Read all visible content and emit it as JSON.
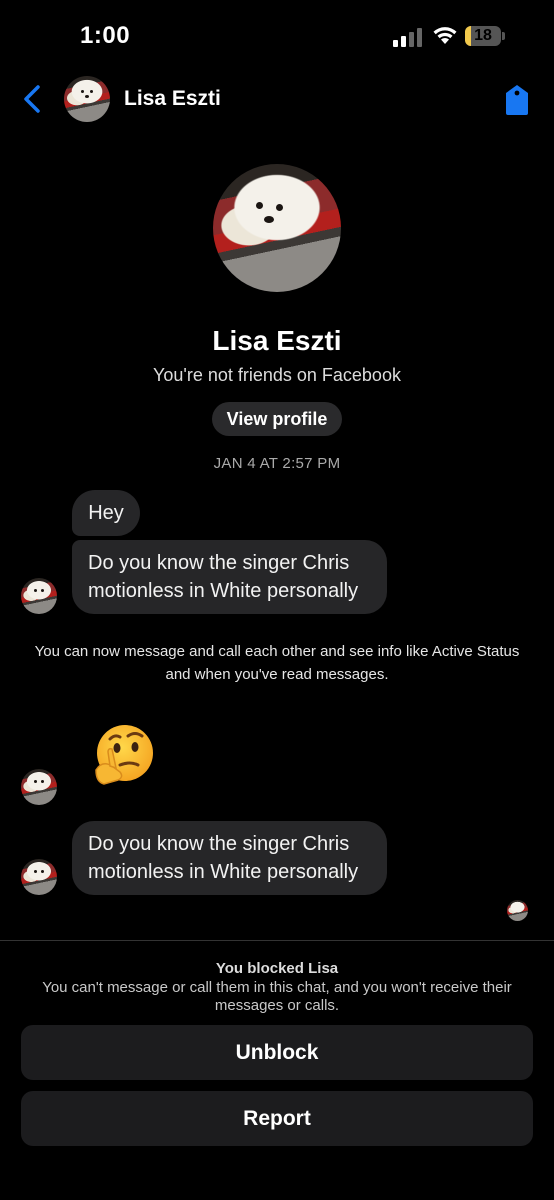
{
  "status_bar": {
    "time": "1:00",
    "battery": "18",
    "battery_level": 0.18,
    "battery_color": "#f2c94c"
  },
  "header": {
    "name": "Lisa Eszti",
    "accent_color": "#1877f2"
  },
  "profile": {
    "name": "Lisa Eszti",
    "subtitle": "You're not friends on Facebook",
    "view_profile_label": "View profile"
  },
  "conversation": {
    "timestamp": "JAN 4 AT 2:57 PM",
    "messages": [
      {
        "text": "Hey"
      },
      {
        "text": "Do you know the singer Chris motionless in White personally"
      }
    ],
    "notice": "You can now message and call each other and see info like Active Status and when you've read messages.",
    "reaction_emoji": "thinking-face",
    "last_message": "Do you know the singer Chris motionless in White personally"
  },
  "blocked": {
    "title": "You blocked Lisa",
    "description": "You can't message or call them in this chat, and you won't receive their messages or calls.",
    "unblock_label": "Unblock",
    "report_label": "Report"
  }
}
